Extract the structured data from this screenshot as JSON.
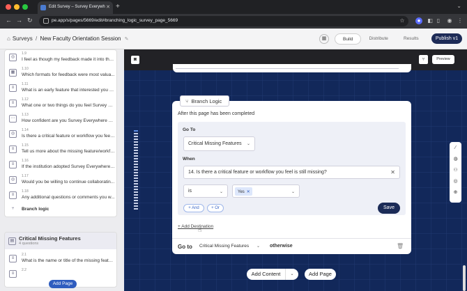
{
  "browser": {
    "tab_title": "Edit Survey – Survey Everywh",
    "url": "pe.app/s/pages/5669/edit#branching_logic_survey_page_5669"
  },
  "header": {
    "home_label": "Surveys",
    "separator": "/",
    "survey_title": "New Faculty Orientation Session",
    "mode_tabs": [
      {
        "label": "Build",
        "active": true
      },
      {
        "label": "Distribute",
        "active": false
      },
      {
        "label": "Results",
        "active": false
      }
    ],
    "publish_label": "Publish v1"
  },
  "sidebar": {
    "questions": [
      {
        "num": "1.9",
        "text": "I feel as though my feedback made it into the ...",
        "icon": "radio-icon"
      },
      {
        "num": "1.10",
        "text": "Which formats for feedback were most valua...",
        "icon": "grid-icon"
      },
      {
        "num": "1.11",
        "text": "What is an early feature that interested you a...",
        "icon": "text-icon"
      },
      {
        "num": "1.12",
        "text": "What one or two things do you feel Survey Ev...",
        "icon": "text-icon"
      },
      {
        "num": "1.13",
        "text": "How confident are you Survey Everywhere m...",
        "icon": "scale-icon"
      },
      {
        "num": "1.14",
        "text": "Is there a critical feature or workflow you feel ...",
        "icon": "radio-icon"
      },
      {
        "num": "1.15",
        "text": "Tell us more about the missing feature/workflo...",
        "icon": "text-icon"
      },
      {
        "num": "1.16",
        "text": "If the institution adopted Survey Everywhere, ...",
        "icon": "text-icon"
      },
      {
        "num": "1.17",
        "text": "Would you be willing to continue collaboratin...",
        "icon": "radio-icon"
      },
      {
        "num": "1.18",
        "text": "Any additional questions or comments you w...",
        "icon": "text-icon"
      }
    ],
    "branch_label": "Branch logic",
    "section2": {
      "title": "Critical Missing Features",
      "subtitle": "4 questions",
      "questions": [
        {
          "num": "2.1",
          "text": "What is the name or title of the missing feature..."
        },
        {
          "num": "2.2",
          "text": ""
        }
      ]
    },
    "add_page_label": "Add Page"
  },
  "canvas": {
    "preview_label": "Preview",
    "branch_tab_label": "Branch Logic",
    "after_text": "After this page has been completed",
    "goto_label": "Go To",
    "goto_value": "Critical Missing Features",
    "when_label": "When",
    "condition_question": "14. Is there a critical feature or workflow you feel is still missing?",
    "operator": "is",
    "value_chip": "Yes",
    "and_label": "+ And",
    "or_label": "+ Or",
    "save_label": "Save",
    "add_destination_label": "+ Add Destination",
    "fallback": {
      "goto": "Go to",
      "destination": "Critical Missing Features",
      "otherwise": "otherwise"
    },
    "add_content_label": "Add Content",
    "add_page_label": "Add Page"
  }
}
